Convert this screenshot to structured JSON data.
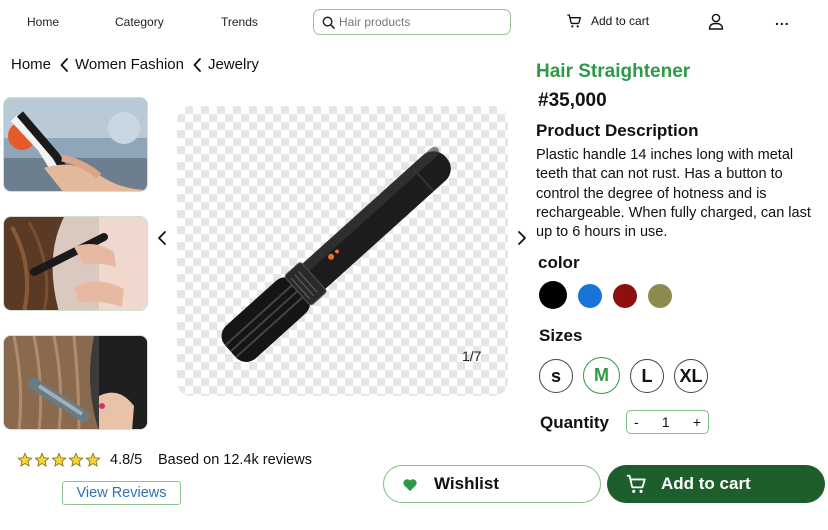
{
  "nav": {
    "home": "Home",
    "category": "Category",
    "trends": "Trends",
    "search_placeholder": "Hair products",
    "add_to_cart": "Add to cart",
    "more": "..."
  },
  "breadcrumb": [
    "Home",
    "Women Fashion",
    "Jewelry"
  ],
  "gallery": {
    "counter": "1/7"
  },
  "product": {
    "title": "Hair Straightener",
    "price": "#35,000",
    "description_heading": "Product Description",
    "description": "Plastic handle 14 inches long with metal teeth that can not rust. Has a button to control the degree of hotness and is rechargeable. When fully charged, can last up to 6 hours in use.",
    "color_label": "color",
    "colors": [
      "#000000",
      "#1a73d9",
      "#8e0f0f",
      "#8c8a4e"
    ],
    "sizes_label": "Sizes",
    "sizes": [
      "s",
      "M",
      "L",
      "XL"
    ],
    "selected_size": "M",
    "quantity_label": "Quantity",
    "quantity": "1",
    "qty_minus": "-",
    "qty_plus": "+"
  },
  "reviews": {
    "stars": 5,
    "rating": "4.8/5",
    "based_on": "Based on 12.4k reviews",
    "view_label": "View Reviews"
  },
  "actions": {
    "wishlist": "Wishlist",
    "add_to_cart": "Add to cart"
  },
  "colors": {
    "accent_green": "#2e9a48",
    "dark_green": "#1d5e2c",
    "link_blue": "#2f6fbb"
  }
}
